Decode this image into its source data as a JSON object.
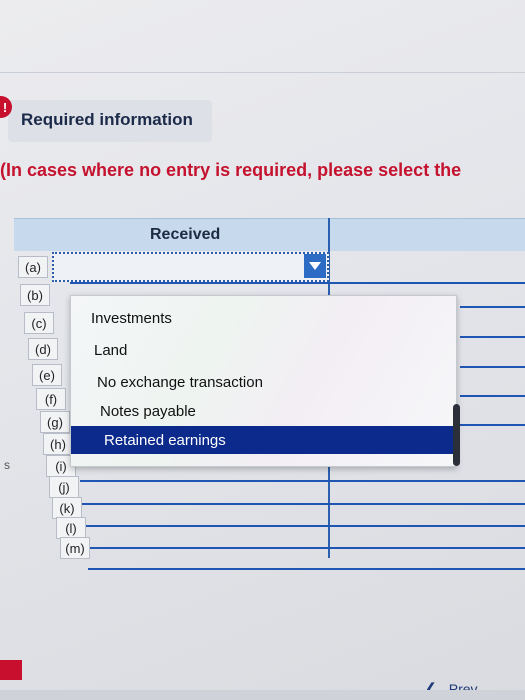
{
  "header": {
    "required_info": "Required information",
    "instruction": "(In cases where no entry is required, please select the"
  },
  "table": {
    "column_header": "Received",
    "rows": [
      "(a)",
      "(b)",
      "(c)",
      "(d)",
      "(e)",
      "(f)",
      "(g)",
      "(h)",
      "(i)",
      "(j)",
      "(k)",
      "(l)",
      "(m)"
    ]
  },
  "dropdown": {
    "options": [
      "Investments",
      "Land",
      "No exchange transaction",
      "Notes payable",
      "Retained earnings"
    ],
    "highlighted": "Retained earnings"
  },
  "nav": {
    "prev_label": "Prev"
  },
  "side_text": "s",
  "icons": [
    "info-icon",
    "chevron-down-icon",
    "chevron-left-icon"
  ],
  "colors": {
    "accent_red": "#c5122e",
    "table_blue": "#1f56b3",
    "selection_navy": "#0b2a8c"
  }
}
